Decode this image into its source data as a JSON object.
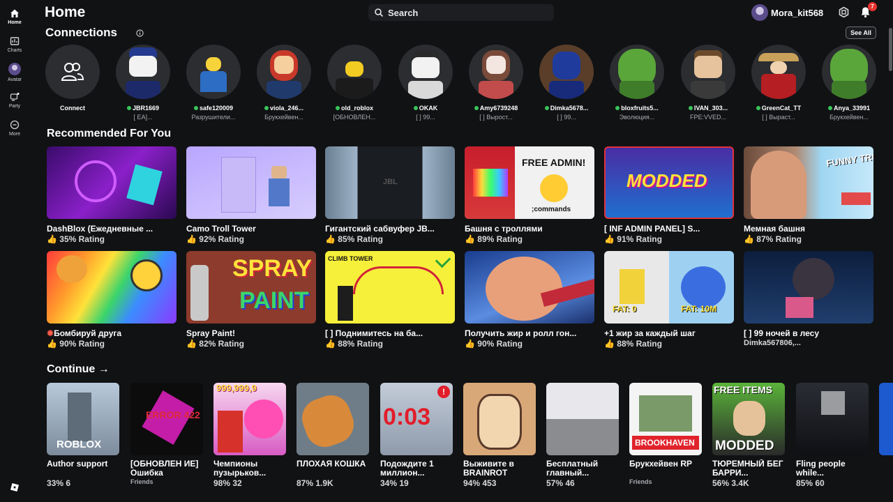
{
  "rail": {
    "items": [
      {
        "label": "Home",
        "icon": "home-icon"
      },
      {
        "label": "Charts",
        "icon": "charts-icon"
      },
      {
        "label": "Avatar",
        "icon": "avatar-icon"
      },
      {
        "label": "Party",
        "icon": "party-icon"
      },
      {
        "label": "More",
        "icon": "more-icon"
      }
    ]
  },
  "header": {
    "title": "Home",
    "search_placeholder": "Search",
    "username": "Mora_kit568",
    "notifications": "7"
  },
  "connections": {
    "title": "Connections",
    "see_all": "See All",
    "connect_label": "Connect",
    "friends": [
      {
        "name": "JBR1669",
        "status": "[ EA]..."
      },
      {
        "name": "safe120009",
        "status": "Разрушители..."
      },
      {
        "name": "viola_246...",
        "status": "Брукхейвен..."
      },
      {
        "name": "old_roblox",
        "status": "[ОБНОВЛЕН..."
      },
      {
        "name": "OKAK",
        "status": "[ ] 99..."
      },
      {
        "name": "Amy6739248",
        "status": "[ ] Вырост..."
      },
      {
        "name": "Dimka5678...",
        "status": "[ ] 99..."
      },
      {
        "name": "bloxfruits5...",
        "status": "Эволюция..."
      },
      {
        "name": "IVAN_303...",
        "status": "FPE:VVED..."
      },
      {
        "name": "GreenCat_TT",
        "status": "[ ] Выраст..."
      },
      {
        "name": "Anya_33991",
        "status": "Брукхейвен..."
      }
    ]
  },
  "recommended": {
    "title": "Recommended For You",
    "games": [
      {
        "title": "DashBlox (Ежедневные ...",
        "rating": "35% Rating"
      },
      {
        "title": "Camo Troll Tower",
        "rating": "92% Rating"
      },
      {
        "title": "Гигантский сабвуфер JB...",
        "rating": "85% Rating"
      },
      {
        "title": "Башня с троллями",
        "rating": "89% Rating"
      },
      {
        "title": "[ INF ADMIN PANEL] S...",
        "rating": "91% Rating"
      },
      {
        "title": "Мемная башня",
        "rating": "87% Rating"
      },
      {
        "title": "Бомбируй друга",
        "rating": "90% Rating"
      },
      {
        "title": "Spray Paint!",
        "rating": "82% Rating"
      },
      {
        "title": "[ ] Поднимитесь на ба...",
        "rating": "88% Rating"
      },
      {
        "title": "Получить жир и ролл гон...",
        "rating": "90% Rating"
      },
      {
        "title": "+1 жир за каждый шаг",
        "rating": "88% Rating"
      },
      {
        "title": "[ ] 99 ночей в лесу",
        "rating": "Dimka567806,..."
      }
    ],
    "thumb_text": {
      "free_admin": "FREE ADMIN!",
      "commands": ";commands",
      "modded": "MODDED",
      "funny_trolls": "FUNNY TROLLS",
      "spray": "SPRAY",
      "paint": "PAINT",
      "fat0": "FAT: 0",
      "fat10m": "FAT: 10M",
      "climb": "CLIMB TOWER",
      "jbl": "JBL"
    }
  },
  "continue": {
    "title": "Continue →",
    "games": [
      {
        "title": "Author support",
        "meta": "33% 6"
      },
      {
        "title": "[ОБНОВЛЕН ИЕ] Ошибка",
        "meta": "Friends"
      },
      {
        "title": "Чемпионы пузырьков...",
        "meta": "98% 32"
      },
      {
        "title": "ПЛОХАЯ КОШКА",
        "meta": "87% 1.9K"
      },
      {
        "title": "Подождите 1 миллион...",
        "meta": "34% 19"
      },
      {
        "title": "Выживите в BRAINROT",
        "meta": "94% 453"
      },
      {
        "title": "Бесплатный главный...",
        "meta": "57% 46"
      },
      {
        "title": "Брукхейвен RP",
        "meta": "Friends"
      },
      {
        "title": "ТЮРЕМНЫЙ БЕГ БАРРИ...",
        "meta": "56% 3.4K"
      },
      {
        "title": "Fling people while...",
        "meta": "85% 60"
      }
    ],
    "thumb_text": {
      "roblox": "ROBLOX",
      "error": "ERROR 422",
      "bubble": "999,999,9",
      "timer": "0:03",
      "brookhaven": "BROOKHAVEN",
      "free_items": "FREE ITEMS",
      "modded": "MODDED"
    }
  }
}
